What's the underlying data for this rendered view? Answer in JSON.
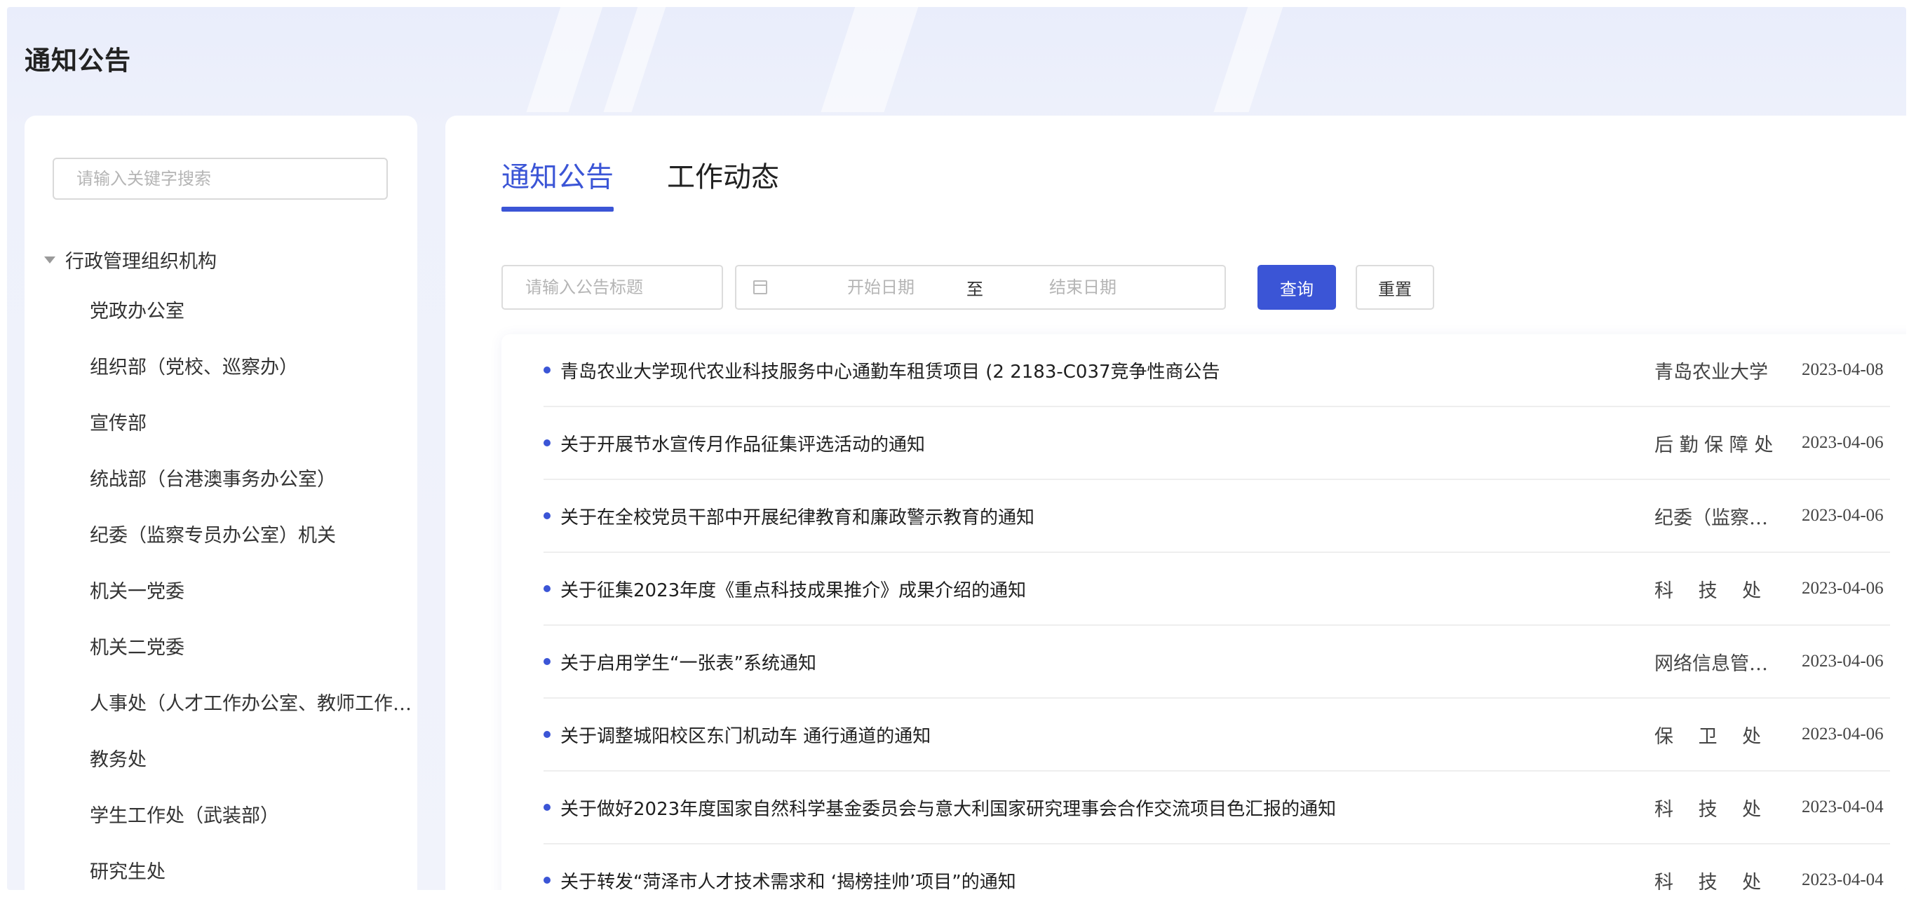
{
  "page": {
    "title": "通知公告"
  },
  "sidebar": {
    "search_placeholder": "请输入关键字搜索",
    "root_label": "行政管理组织机构",
    "items": [
      "党政办公室",
      "组织部（党校、巡察办）",
      "宣传部",
      "统战部（台港澳事务办公室）",
      "纪委（监察专员办公室）机关",
      "机关一党委",
      "机关二党委",
      "人事处（人才工作办公室、教师工作…",
      "教务处",
      "学生工作处（武装部）",
      "研究生处"
    ]
  },
  "main": {
    "tabs": [
      {
        "label": "通知公告",
        "active": true
      },
      {
        "label": "工作动态",
        "active": false
      }
    ],
    "filters": {
      "title_placeholder": "请输入公告标题",
      "start_placeholder": "开始日期",
      "separator": "至",
      "end_placeholder": "结束日期",
      "query_label": "查询",
      "reset_label": "重置"
    },
    "notices": [
      {
        "title": "青岛农业大学现代农业科技服务中心通勤车租赁项目 (2 2183-C037竞争性商公告",
        "dept": "青岛农业大学",
        "date": "2023-04-08"
      },
      {
        "title": "关于开展节水宣传月作品征集评选活动的通知",
        "dept": "后 勤 保 障 处",
        "date": "2023-04-06"
      },
      {
        "title": "关于在全校党员干部中开展纪律教育和廉政警示教育的通知",
        "dept": "纪委（监察…",
        "date": "2023-04-06"
      },
      {
        "title": "关于征集2023年度《重点科技成果推介》成果介绍的通知",
        "dept": "科　 技　 处",
        "date": "2023-04-06"
      },
      {
        "title": "关于启用学生“一张表”系统通知",
        "dept": "网络信息管…",
        "date": "2023-04-06"
      },
      {
        "title": "关于调整城阳校区东门机动车 通行通道的通知",
        "dept": "保　 卫　 处",
        "date": "2023-04-06"
      },
      {
        "title": "关于做好2023年度国家自然科学基金委员会与意大利国家研究理事会合作交流项目色汇报的通知",
        "dept": "科　 技　 处",
        "date": "2023-04-04"
      },
      {
        "title": "关于转发“菏泽市人才技术需求和 ‘揭榜挂帅’项目”的通知",
        "dept": "科　 技　 处",
        "date": "2023-04-04"
      }
    ]
  },
  "colors": {
    "accent": "#3b55d6",
    "background": "#eef1fb"
  }
}
